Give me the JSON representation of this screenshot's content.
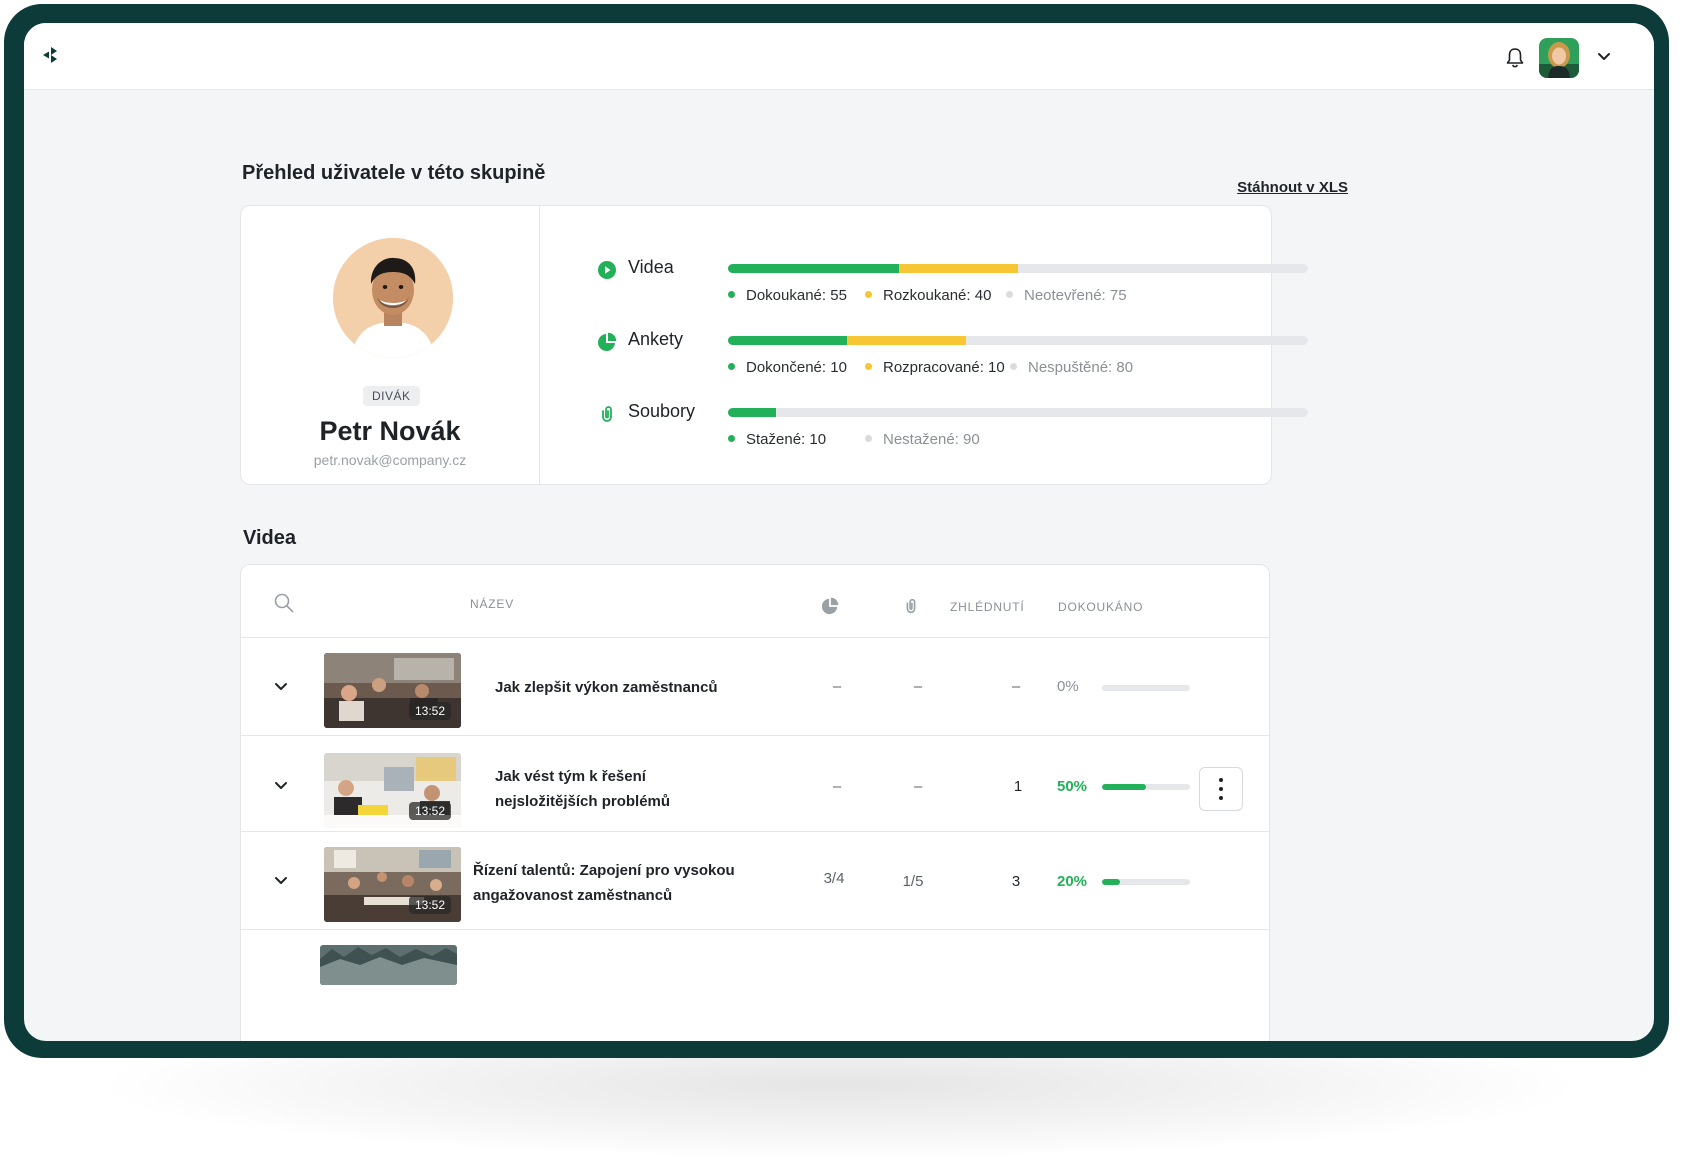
{
  "header": {
    "logo_icon": "logo-mark-icon",
    "bell_icon": "bell-icon",
    "user_avatar": "user-avatar",
    "menu_icon": "chevron-down-icon"
  },
  "overview": {
    "title": "Přehled uživatele v této skupině",
    "download_label": "Stáhnout v XLS"
  },
  "profile": {
    "role": "DIVÁK",
    "name": "Petr Novák",
    "email": "petr.novak@company.cz"
  },
  "stats": [
    {
      "label": "Videa",
      "icon": "play-circle-icon",
      "progress": {
        "done": 55,
        "in_progress": 40,
        "not_started": 75
      },
      "legend": [
        "Dokoukané: 55",
        "Rozkoukané: 40",
        "Neotevřené: 75"
      ]
    },
    {
      "label": "Ankety",
      "icon": "pie-chart-icon",
      "progress": {
        "done": 10,
        "in_progress": 10,
        "not_started": 80
      },
      "legend": [
        "Dokončené: 10",
        "Rozpracované: 10",
        "Nespuštěné: 80"
      ]
    },
    {
      "label": "Soubory",
      "icon": "paperclip-icon",
      "progress": {
        "done": 10,
        "in_progress": 0,
        "not_started": 90
      },
      "legend": [
        "Stažené: 10",
        "Nestažené: 90"
      ]
    }
  ],
  "colors": {
    "frame": "#0c3b3a",
    "accent_green": "#22b159",
    "accent_yellow": "#f6c634",
    "track": "#e6e7ea"
  },
  "videos": {
    "title": "Videa",
    "columns": {
      "search_icon": "search-icon",
      "name": "NÁZEV",
      "polls_icon": "pie-chart-icon",
      "files_icon": "paperclip-icon",
      "views": "ZHLÉDNUTÍ",
      "completed": "DOKOUKÁNO"
    },
    "rows": [
      {
        "title_lines": [
          "Jak zlepšit výkon zaměstnanců"
        ],
        "duration": "13:52",
        "polls": "–",
        "files": "–",
        "views": "–",
        "completed": "0%",
        "completed_value": 0
      },
      {
        "title_lines": [
          "Jak vést tým k řešení",
          "nejsložitějších problémů"
        ],
        "duration": "13:52",
        "polls": "–",
        "files": "–",
        "views": "1",
        "completed": "50%",
        "completed_value": 0.5
      },
      {
        "title_lines": [
          "Řízení talentů: Zapojení pro vysokou",
          "angažovanost zaměstnanců"
        ],
        "duration": "13:52",
        "polls": "3/4",
        "files": "1/5",
        "views": "3",
        "completed": "20%",
        "completed_value": 0.2
      }
    ]
  }
}
